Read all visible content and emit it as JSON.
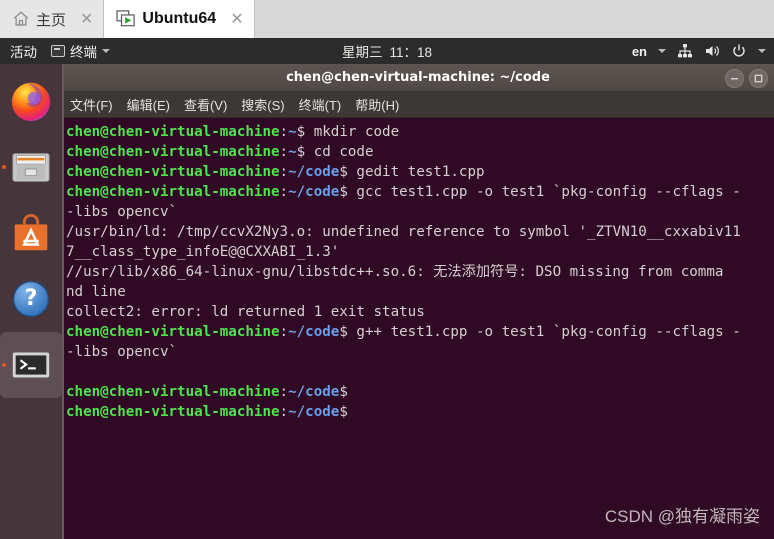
{
  "vmware": {
    "tabs": [
      {
        "label": "主页",
        "icon": "home-icon",
        "active": false,
        "close": "✕"
      },
      {
        "label": "Ubuntu64",
        "icon": "virtual-machine-icon",
        "active": true,
        "close": "✕"
      }
    ]
  },
  "gnome_panel": {
    "activities": "活动",
    "app_menu": "终端",
    "app_menu_icon": "terminal-icon",
    "date": "星期三",
    "time": "11：18",
    "keyboard_layout": "en",
    "indicators": [
      "network-icon",
      "volume-icon",
      "power-icon"
    ]
  },
  "dock": {
    "items": [
      {
        "name": "firefox",
        "label": "Firefox",
        "running": false,
        "active": false
      },
      {
        "name": "files",
        "label": "文件",
        "running": true,
        "active": false
      },
      {
        "name": "ubuntu-software",
        "label": "Ubuntu 软件",
        "running": false,
        "active": false
      },
      {
        "name": "help",
        "label": "帮助",
        "running": false,
        "active": false
      },
      {
        "name": "terminal",
        "label": "终端",
        "running": true,
        "active": true
      }
    ]
  },
  "terminal": {
    "title": "chen@chen-virtual-machine: ~/code",
    "window_buttons": [
      "minimize",
      "maximize"
    ],
    "menu": [
      "文件(F)",
      "编辑(E)",
      "查看(V)",
      "搜索(S)",
      "终端(T)",
      "帮助(H)"
    ],
    "prompt_user": "chen@chen-virtual-machine",
    "lines": [
      {
        "type": "prompt",
        "user": "chen@chen-virtual-machine",
        "path": "~",
        "cmd": " mkdir code"
      },
      {
        "type": "prompt",
        "user": "chen@chen-virtual-machine",
        "path": "~",
        "cmd": " cd code"
      },
      {
        "type": "prompt",
        "user": "chen@chen-virtual-machine",
        "path": "~/code",
        "cmd": " gedit test1.cpp"
      },
      {
        "type": "prompt",
        "user": "chen@chen-virtual-machine",
        "path": "~/code",
        "cmd": " gcc test1.cpp -o test1 `pkg-config --cflags -"
      },
      {
        "type": "output",
        "text": "-libs opencv`"
      },
      {
        "type": "output",
        "text": "/usr/bin/ld: /tmp/ccvX2Ny3.o: undefined reference to symbol '_ZTVN10__cxxabiv11"
      },
      {
        "type": "output",
        "text": "7__class_type_infoE@@CXXABI_1.3'"
      },
      {
        "type": "output",
        "text": "//usr/lib/x86_64-linux-gnu/libstdc++.so.6: 无法添加符号: DSO missing from comma"
      },
      {
        "type": "output",
        "text": "nd line"
      },
      {
        "type": "output",
        "text": "collect2: error: ld returned 1 exit status"
      },
      {
        "type": "prompt",
        "user": "chen@chen-virtual-machine",
        "path": "~/code",
        "cmd": " g++ test1.cpp -o test1 `pkg-config --cflags -"
      },
      {
        "type": "output",
        "text": "-libs opencv`"
      },
      {
        "type": "output",
        "text": ""
      },
      {
        "type": "prompt",
        "user": "chen@chen-virtual-machine",
        "path": "~/code",
        "cmd": ""
      },
      {
        "type": "prompt",
        "user": "chen@chen-virtual-machine",
        "path": "~/code",
        "cmd": ""
      }
    ]
  },
  "watermark": "CSDN @独有凝雨姿",
  "colors": {
    "terminal_bg": "#300a24",
    "dock_bg": "#46353a",
    "panel_bg": "#2c2c2c",
    "prompt_green": "#4ee44e",
    "prompt_blue": "#6b9fe8",
    "accent_orange": "#e95420"
  }
}
